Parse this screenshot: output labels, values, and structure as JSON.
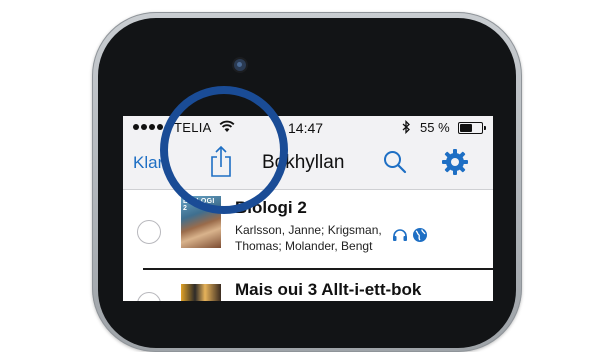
{
  "status_bar": {
    "carrier": "TELIA",
    "time": "14:47",
    "battery_percent": "55 %",
    "battery_level": 0.55,
    "icons": [
      "signal-dots",
      "wifi-icon",
      "bluetooth-icon",
      "battery-icon"
    ]
  },
  "navbar": {
    "left_label": "Klar",
    "title": "Bokhyllan",
    "icons": [
      "share-icon",
      "search-icon",
      "gear-icon"
    ],
    "accent_color": "#1e6fc4"
  },
  "books": [
    {
      "title": "Biologi 2",
      "cover_label": "BIOLOGI 2",
      "authors_line1": "Karlsson, Janne; Krigsman,",
      "authors_line2": "Thomas; Molander, Bengt",
      "icons": [
        "headphones-icon",
        "globe-icon"
      ]
    },
    {
      "title": "Mais oui 3 Allt-i-ett-bok"
    }
  ],
  "annotation": {
    "color": "#1a4c96"
  }
}
